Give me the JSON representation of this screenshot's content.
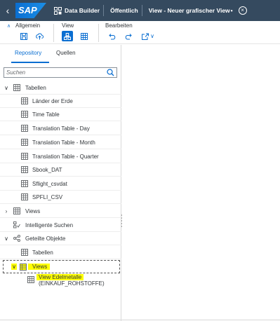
{
  "shell": {
    "back_icon": "back-icon",
    "logo": "SAP",
    "app": "Data Builder",
    "space": "Öffentlich",
    "title": "View - Neuer grafischer View",
    "modified_marker": "•",
    "close_icon": "close-icon"
  },
  "toolbar": {
    "groups": [
      {
        "label": "Allgemein",
        "icons": [
          "save-icon",
          "deploy-icon"
        ]
      },
      {
        "label": "View",
        "icons": [
          "graphical-view-icon",
          "table-view-icon"
        ]
      },
      {
        "label": "Bearbeiten",
        "icons": [
          "undo-icon",
          "redo-icon",
          "export-icon",
          "chevron-down-icon"
        ]
      }
    ]
  },
  "panel": {
    "tabs": [
      "Repository",
      "Quellen"
    ],
    "selected_tab": "Repository",
    "search_placeholder": "Suchen",
    "tree": [
      {
        "label": "Tabellen",
        "level": 0,
        "expanded": true,
        "icon": "table-icon"
      },
      {
        "label": "Länder der Erde",
        "level": 1,
        "icon": "table-icon"
      },
      {
        "label": "Time Table",
        "level": 1,
        "icon": "table-icon"
      },
      {
        "label": "Translation Table - Day",
        "level": 1,
        "icon": "table-icon"
      },
      {
        "label": "Translation Table - Month",
        "level": 1,
        "icon": "table-icon"
      },
      {
        "label": "Translation Table - Quarter",
        "level": 1,
        "icon": "table-icon"
      },
      {
        "label": "Sbook_DAT",
        "level": 1,
        "icon": "table-icon"
      },
      {
        "label": "Sflight_csvdat",
        "level": 1,
        "icon": "table-icon"
      },
      {
        "label": "SPFLI_CSV",
        "level": 1,
        "icon": "table-icon"
      },
      {
        "label": "Views",
        "level": 0,
        "expanded": false,
        "icon": "table-icon"
      },
      {
        "label": "Intelligente Suchen",
        "level": 0,
        "icon": "intelligent-lookup-icon"
      },
      {
        "label": "Geteilte Objekte",
        "level": 0,
        "expanded": true,
        "icon": "share-icon"
      },
      {
        "label": "Tabellen",
        "level": 1,
        "icon": "table-icon"
      },
      {
        "label": "Views",
        "level": 1,
        "expanded": true,
        "icon": "view-icon",
        "highlighted": true
      },
      {
        "label": "View Edelmetalle",
        "sublabel": "(EINKAUF_ROHSTOFFE)",
        "level": 2,
        "icon": "table-icon",
        "highlighted": true
      }
    ]
  },
  "colors": {
    "shell_bg": "#354a5f",
    "accent": "#0a6ed1",
    "highlight": "#ffff00"
  }
}
